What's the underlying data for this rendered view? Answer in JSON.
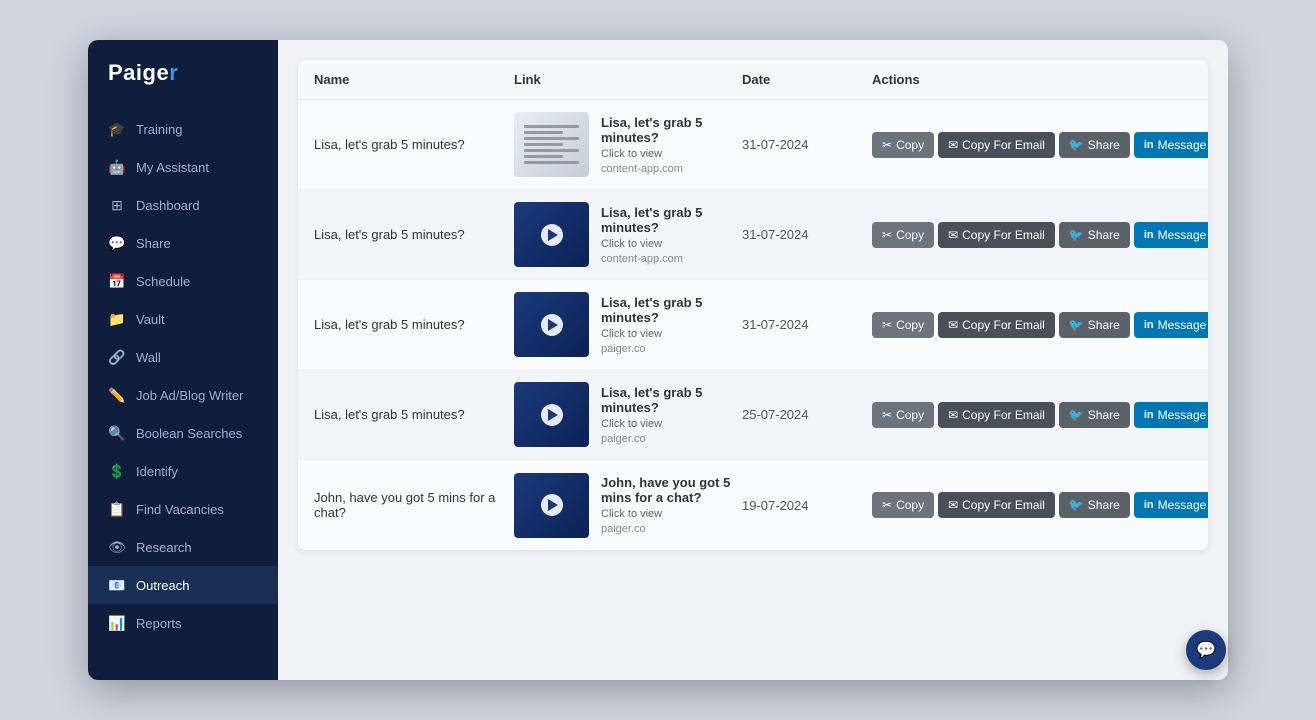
{
  "app": {
    "name": "Paiger",
    "logo_dot": "r"
  },
  "sidebar": {
    "items": [
      {
        "id": "training",
        "label": "Training",
        "icon": "🎓",
        "active": false
      },
      {
        "id": "my-assistant",
        "label": "My Assistant",
        "icon": "🤖",
        "active": false
      },
      {
        "id": "dashboard",
        "label": "Dashboard",
        "icon": "⊞",
        "active": false
      },
      {
        "id": "share",
        "label": "Share",
        "icon": "💬",
        "active": false
      },
      {
        "id": "schedule",
        "label": "Schedule",
        "icon": "📅",
        "active": false
      },
      {
        "id": "vault",
        "label": "Vault",
        "icon": "📁",
        "active": false
      },
      {
        "id": "wall",
        "label": "Wall",
        "icon": "🔗",
        "active": false
      },
      {
        "id": "job-ad-blog-writer",
        "label": "Job Ad/Blog Writer",
        "icon": "✏️",
        "active": false
      },
      {
        "id": "boolean-searches",
        "label": "Boolean Searches",
        "icon": "🔍",
        "active": false
      },
      {
        "id": "identify",
        "label": "Identify",
        "icon": "💲",
        "active": false
      },
      {
        "id": "find-vacancies",
        "label": "Find Vacancies",
        "icon": "📋",
        "active": false
      },
      {
        "id": "research",
        "label": "Research",
        "icon": "👁",
        "active": false
      },
      {
        "id": "outreach",
        "label": "Outreach",
        "icon": "📧",
        "active": true
      },
      {
        "id": "reports",
        "label": "Reports",
        "icon": "📊",
        "active": false
      }
    ]
  },
  "table": {
    "columns": [
      "Name",
      "Link",
      "Date",
      "Actions"
    ],
    "rows": [
      {
        "name": "Lisa, let's grab 5 minutes?",
        "link_title": "Lisa, let's grab 5 minutes?",
        "link_click": "Click to view",
        "link_url": "content-app.com",
        "thumb_type": "document",
        "date": "31-07-2024"
      },
      {
        "name": "Lisa, let's grab 5 minutes?",
        "link_title": "Lisa, let's grab 5 minutes?",
        "link_click": "Click to view",
        "link_url": "content-app.com",
        "thumb_type": "video",
        "date": "31-07-2024"
      },
      {
        "name": "Lisa, let's grab 5 minutes?",
        "link_title": "Lisa, let's grab 5 minutes?",
        "link_click": "Click to view",
        "link_url": "paiger.co",
        "thumb_type": "video",
        "date": "31-07-2024"
      },
      {
        "name": "Lisa, let's grab 5 minutes?",
        "link_title": "Lisa, let's grab 5 minutes?",
        "link_click": "Click to view",
        "link_url": "paiger.co",
        "thumb_type": "video",
        "date": "25-07-2024"
      },
      {
        "name": "John, have you got 5 mins for a chat?",
        "link_title": "John, have you got 5 mins for a chat?",
        "link_click": "Click to view",
        "link_url": "paiger.co",
        "thumb_type": "video",
        "date": "19-07-2024"
      }
    ],
    "actions": {
      "copy": "Copy",
      "copy_email": "Copy For Email",
      "share": "Share",
      "message": "Message"
    }
  }
}
